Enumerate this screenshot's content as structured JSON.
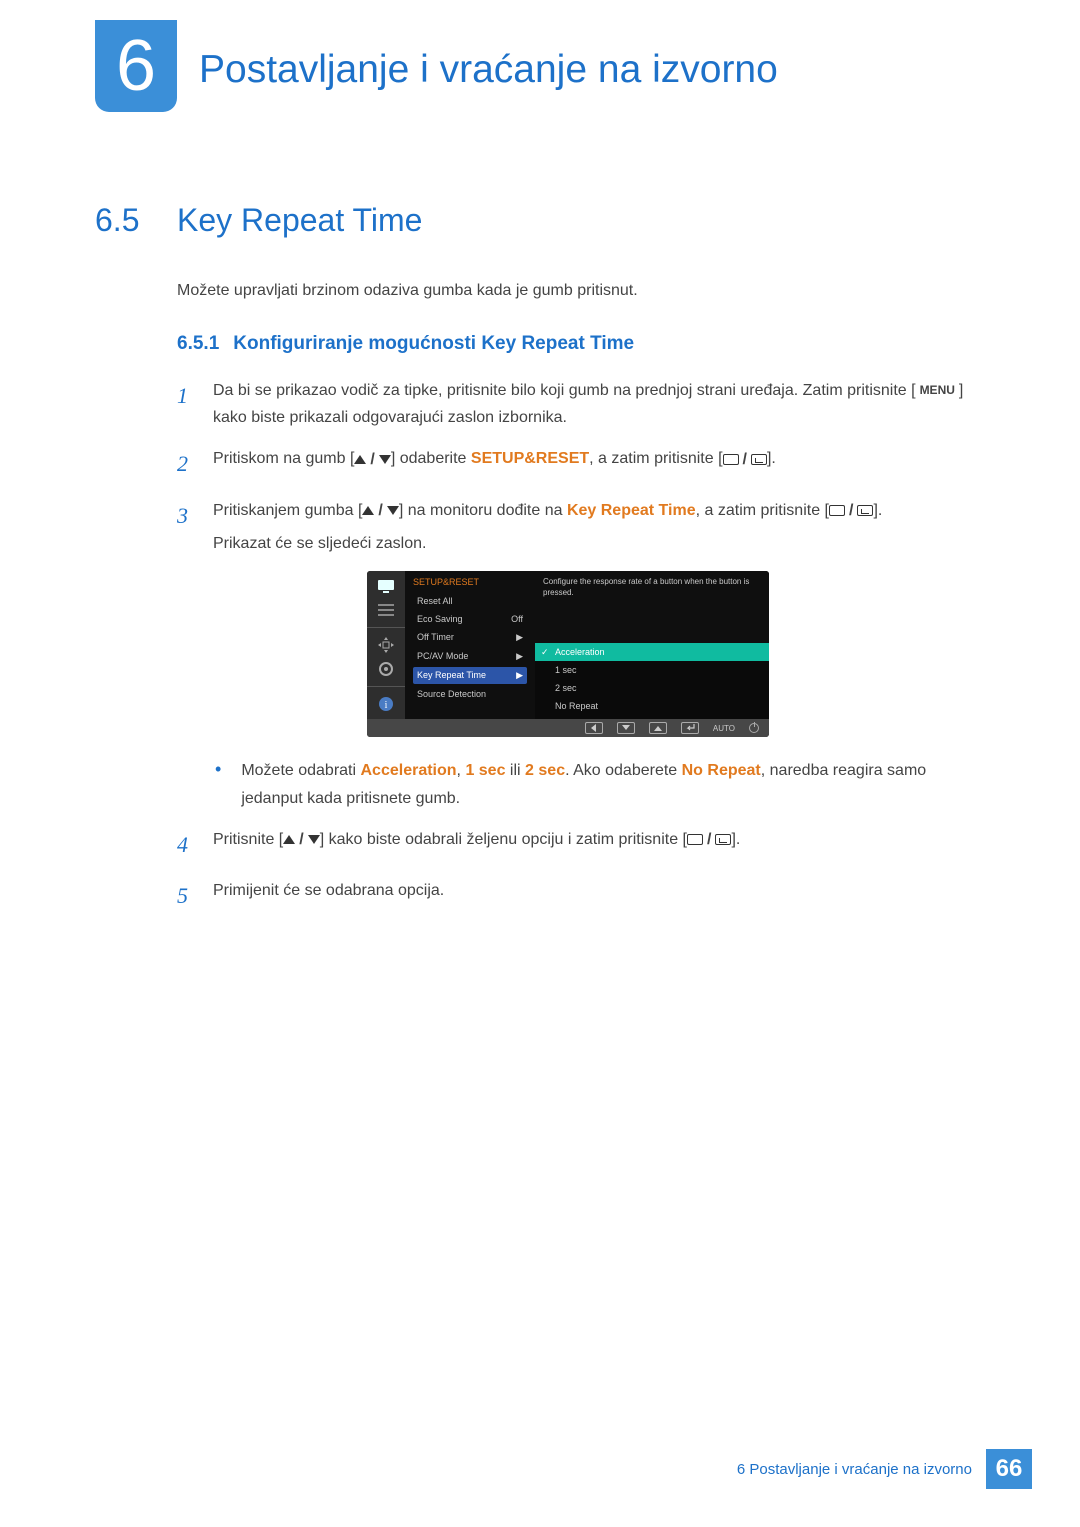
{
  "chapter": {
    "number": "6",
    "title": "Postavljanje i vraćanje na izvorno"
  },
  "section": {
    "number": "6.5",
    "title": "Key Repeat Time",
    "intro": "Možete upravljati brzinom odaziva gumba kada je gumb pritisnut."
  },
  "subsection": {
    "number": "6.5.1",
    "title": "Konfiguriranje mogućnosti Key Repeat Time"
  },
  "steps": {
    "s1": {
      "num": "1",
      "text_a": "Da bi se prikazao vodič za tipke, pritisnite bilo koji gumb na prednjoj strani uređaja. Zatim pritisnite [",
      "menu": "MENU",
      "text_b": "] kako biste prikazali odgovarajući zaslon izbornika."
    },
    "s2": {
      "num": "2",
      "text_a": "Pritiskom na gumb [",
      "text_b": "] odaberite ",
      "kw": "SETUP&RESET",
      "text_c": ", a zatim pritisnite [",
      "text_d": "]."
    },
    "s3": {
      "num": "3",
      "text_a": "Pritiskanjem gumba [",
      "text_b": "] na monitoru dođite na ",
      "kw": "Key Repeat Time",
      "text_c": ", a zatim pritisnite [",
      "text_d": "].",
      "after": "Prikazat će se sljedeći zaslon."
    },
    "s4": {
      "num": "4",
      "text_a": "Pritisnite [",
      "text_b": "] kako biste odabrali željenu opciju i zatim pritisnite [",
      "text_c": "]."
    },
    "s5": {
      "num": "5",
      "text": "Primijenit će se odabrana opcija."
    }
  },
  "bullet": {
    "a": "Možete odabrati ",
    "k1": "Acceleration",
    "sep1": ", ",
    "k2": "1 sec",
    "mid": " ili ",
    "k3": "2 sec",
    "b": ". Ako odaberete ",
    "k4": "No Repeat",
    "c": ", naredba reagira samo jedanput kada pritisnete gumb."
  },
  "osd": {
    "title": "SETUP&RESET",
    "items": {
      "reset": "Reset All",
      "eco": "Eco Saving",
      "eco_val": "Off",
      "offtimer": "Off Timer",
      "pcav": "PC/AV Mode",
      "keyrepeat": "Key Repeat Time",
      "source": "Source Detection"
    },
    "dropdown": {
      "acc": "Acceleration",
      "one": "1 sec",
      "two": "2 sec",
      "norepeat": "No Repeat"
    },
    "help": "Configure the response rate of a button when the button is pressed.",
    "auto": "AUTO"
  },
  "footer": {
    "text": "6 Postavljanje i vraćanje na izvorno",
    "page": "66"
  }
}
